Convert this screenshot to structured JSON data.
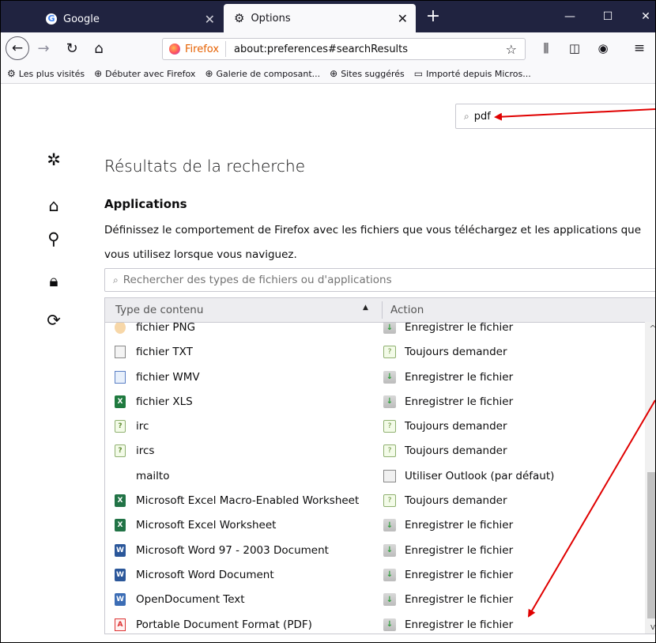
{
  "tabs": [
    {
      "title": "Google",
      "icon": "google-icon"
    },
    {
      "title": "Options",
      "icon": "gear-icon"
    }
  ],
  "window_controls": {
    "minimize": "—",
    "maximize": "☐",
    "close": "✕"
  },
  "navbar": {
    "identity_label": "Firefox",
    "url": "about:preferences#searchResults"
  },
  "bookmarks": [
    {
      "label": "Les plus visités",
      "icon": "gear-icon"
    },
    {
      "label": "Débuter avec Firefox",
      "icon": "globe-icon"
    },
    {
      "label": "Galerie de composant...",
      "icon": "globe-icon"
    },
    {
      "label": "Sites suggérés",
      "icon": "globe-icon"
    },
    {
      "label": "Importé depuis Micros...",
      "icon": "folder-icon"
    }
  ],
  "search": {
    "value": "pdf"
  },
  "page": {
    "title": "Résultats de la recherche",
    "section_title": "Applications",
    "description_line1": "Définissez le comportement de Firefox avec les fichiers que vous téléchargez et les applications que",
    "description_line2": "vous utilisez lorsque vous naviguez.",
    "filter_placeholder": "Rechercher des types de fichiers ou d'applications"
  },
  "table": {
    "col_content_type": "Type de contenu",
    "col_action": "Action",
    "rows": [
      {
        "type": "fichier PNG",
        "icon": "png",
        "action": "Enregistrer le fichier",
        "action_icon": "save"
      },
      {
        "type": "fichier TXT",
        "icon": "txt",
        "action": "Toujours demander",
        "action_icon": "ask"
      },
      {
        "type": "fichier WMV",
        "icon": "wmv",
        "action": "Enregistrer le fichier",
        "action_icon": "save"
      },
      {
        "type": "fichier XLS",
        "icon": "xls",
        "action": "Enregistrer le fichier",
        "action_icon": "save"
      },
      {
        "type": "irc",
        "icon": "irc",
        "action": "Toujours demander",
        "action_icon": "ask"
      },
      {
        "type": "ircs",
        "icon": "irc",
        "action": "Toujours demander",
        "action_icon": "ask"
      },
      {
        "type": "mailto",
        "icon": "none",
        "action": "Utiliser Outlook (par défaut)",
        "action_icon": "app"
      },
      {
        "type": "Microsoft Excel Macro-Enabled Worksheet",
        "icon": "xlsm",
        "action": "Toujours demander",
        "action_icon": "ask"
      },
      {
        "type": "Microsoft Excel Worksheet",
        "icon": "xlsm",
        "action": "Enregistrer le fichier",
        "action_icon": "save"
      },
      {
        "type": "Microsoft Word 97 - 2003 Document",
        "icon": "doc",
        "action": "Enregistrer le fichier",
        "action_icon": "save"
      },
      {
        "type": "Microsoft Word Document",
        "icon": "doc",
        "action": "Enregistrer le fichier",
        "action_icon": "save"
      },
      {
        "type": "OpenDocument Text",
        "icon": "odt",
        "action": "Enregistrer le fichier",
        "action_icon": "save"
      },
      {
        "type": "Portable Document Format (PDF)",
        "icon": "pdf",
        "action": "Enregistrer le fichier",
        "action_icon": "save"
      }
    ]
  },
  "colors": {
    "tabstrip": "#202340",
    "annotation_arrow": "#e00000",
    "firefox_orange": "#e66000"
  }
}
